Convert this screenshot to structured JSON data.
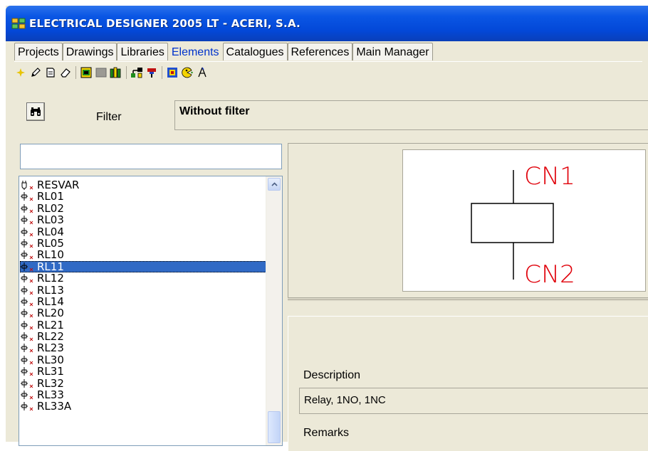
{
  "window": {
    "title": "ELECTRICAL DESIGNER 2005 LT - ACERI, S.A.",
    "title_color": "#0a56e4",
    "background": "#ece9d8"
  },
  "tabs": [
    {
      "label": "Projects",
      "active": false
    },
    {
      "label": "Drawings",
      "active": false
    },
    {
      "label": "Libraries",
      "active": false
    },
    {
      "label": "Elements",
      "active": true
    },
    {
      "label": "Catalogues",
      "active": false
    },
    {
      "label": "References",
      "active": false
    },
    {
      "label": "Main Manager",
      "active": false
    }
  ],
  "toolbar": {
    "icons": [
      "new-star-icon",
      "pencil-icon",
      "document-icon",
      "eraser-icon",
      "component-icon",
      "gray-block-icon",
      "books-icon",
      "network-icon",
      "connector-icon",
      "grid-select-icon",
      "pie-icon",
      "compass-icon"
    ]
  },
  "filter": {
    "label": "Filter",
    "value": "Without filter",
    "find_icon": "binoculars-icon"
  },
  "search": {
    "value": "",
    "placeholder": ""
  },
  "element_list": {
    "selected_color": "#316ac5",
    "items": [
      {
        "label": "RESVAR",
        "icon": "resistor-symbol-icon",
        "selected": false
      },
      {
        "label": "RL01",
        "icon": "relay-symbol-icon",
        "selected": false
      },
      {
        "label": "RL02",
        "icon": "relay-symbol-icon",
        "selected": false
      },
      {
        "label": "RL03",
        "icon": "relay-symbol-icon",
        "selected": false
      },
      {
        "label": "RL04",
        "icon": "relay-symbol-icon",
        "selected": false
      },
      {
        "label": "RL05",
        "icon": "relay-symbol-icon",
        "selected": false
      },
      {
        "label": "RL10",
        "icon": "relay-symbol-icon",
        "selected": false
      },
      {
        "label": "RL11",
        "icon": "relay-symbol-icon",
        "selected": true
      },
      {
        "label": "RL12",
        "icon": "relay-symbol-icon",
        "selected": false
      },
      {
        "label": "RL13",
        "icon": "relay-symbol-icon",
        "selected": false
      },
      {
        "label": "RL14",
        "icon": "relay-symbol-icon",
        "selected": false
      },
      {
        "label": "RL20",
        "icon": "relay-symbol-icon",
        "selected": false
      },
      {
        "label": "RL21",
        "icon": "relay-symbol-icon",
        "selected": false
      },
      {
        "label": "RL22",
        "icon": "relay-symbol-icon",
        "selected": false
      },
      {
        "label": "RL23",
        "icon": "relay-symbol-icon",
        "selected": false
      },
      {
        "label": "RL30",
        "icon": "relay-symbol-icon",
        "selected": false
      },
      {
        "label": "RL31",
        "icon": "relay-symbol-icon",
        "selected": false
      },
      {
        "label": "RL32",
        "icon": "relay-symbol-icon",
        "selected": false
      },
      {
        "label": "RL33",
        "icon": "relay-symbol-icon",
        "selected": false
      },
      {
        "label": "RL33A",
        "icon": "relay-symbol-icon",
        "selected": false
      }
    ]
  },
  "preview": {
    "top_terminal": "CN1",
    "bottom_terminal": "CN2",
    "label_color": "#e0000a",
    "symbol": "relay-coil-symbol"
  },
  "details": {
    "description_label": "Description",
    "description_value": "Relay, 1NO, 1NC",
    "remarks_label": "Remarks"
  }
}
